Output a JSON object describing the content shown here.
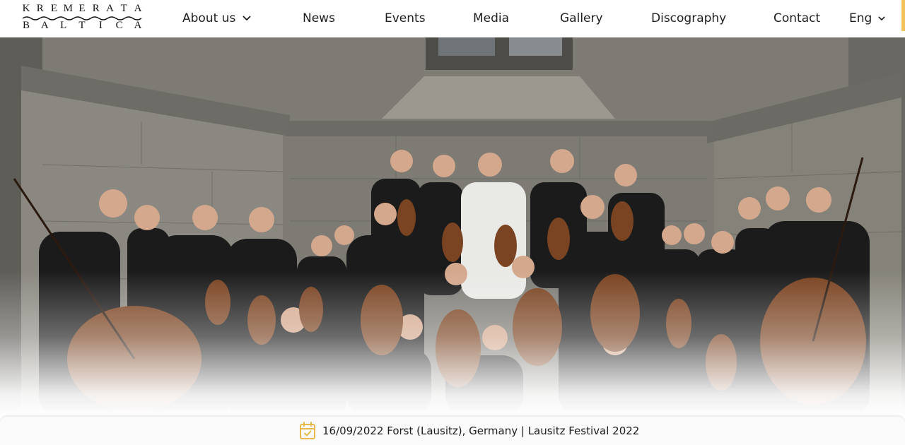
{
  "brand": {
    "logo_top": [
      "K",
      "R",
      "E",
      "M",
      "E",
      "R",
      "A",
      "T",
      "A"
    ],
    "logo_bottom": [
      "B",
      "A",
      "L",
      "T",
      "I",
      "C",
      "A"
    ],
    "logo_alt": "Kremerata Baltica"
  },
  "nav": {
    "about": "About us",
    "news": "News",
    "events": "Events",
    "media": "Media",
    "gallery": "Gallery",
    "discography": "Discography",
    "contact": "Contact",
    "language": "Eng"
  },
  "hero": {
    "image_subject": "Orchestra group photo with string instruments in front of a stone church wall"
  },
  "event_bar": {
    "icon": "calendar-check-icon",
    "text": "16/09/2022 Forst (Lausitz), Germany | Lausitz Festival 2022"
  },
  "colors": {
    "accent": "#e8b94a",
    "text": "#1e1e1e",
    "header_bg": "#ffffff"
  }
}
